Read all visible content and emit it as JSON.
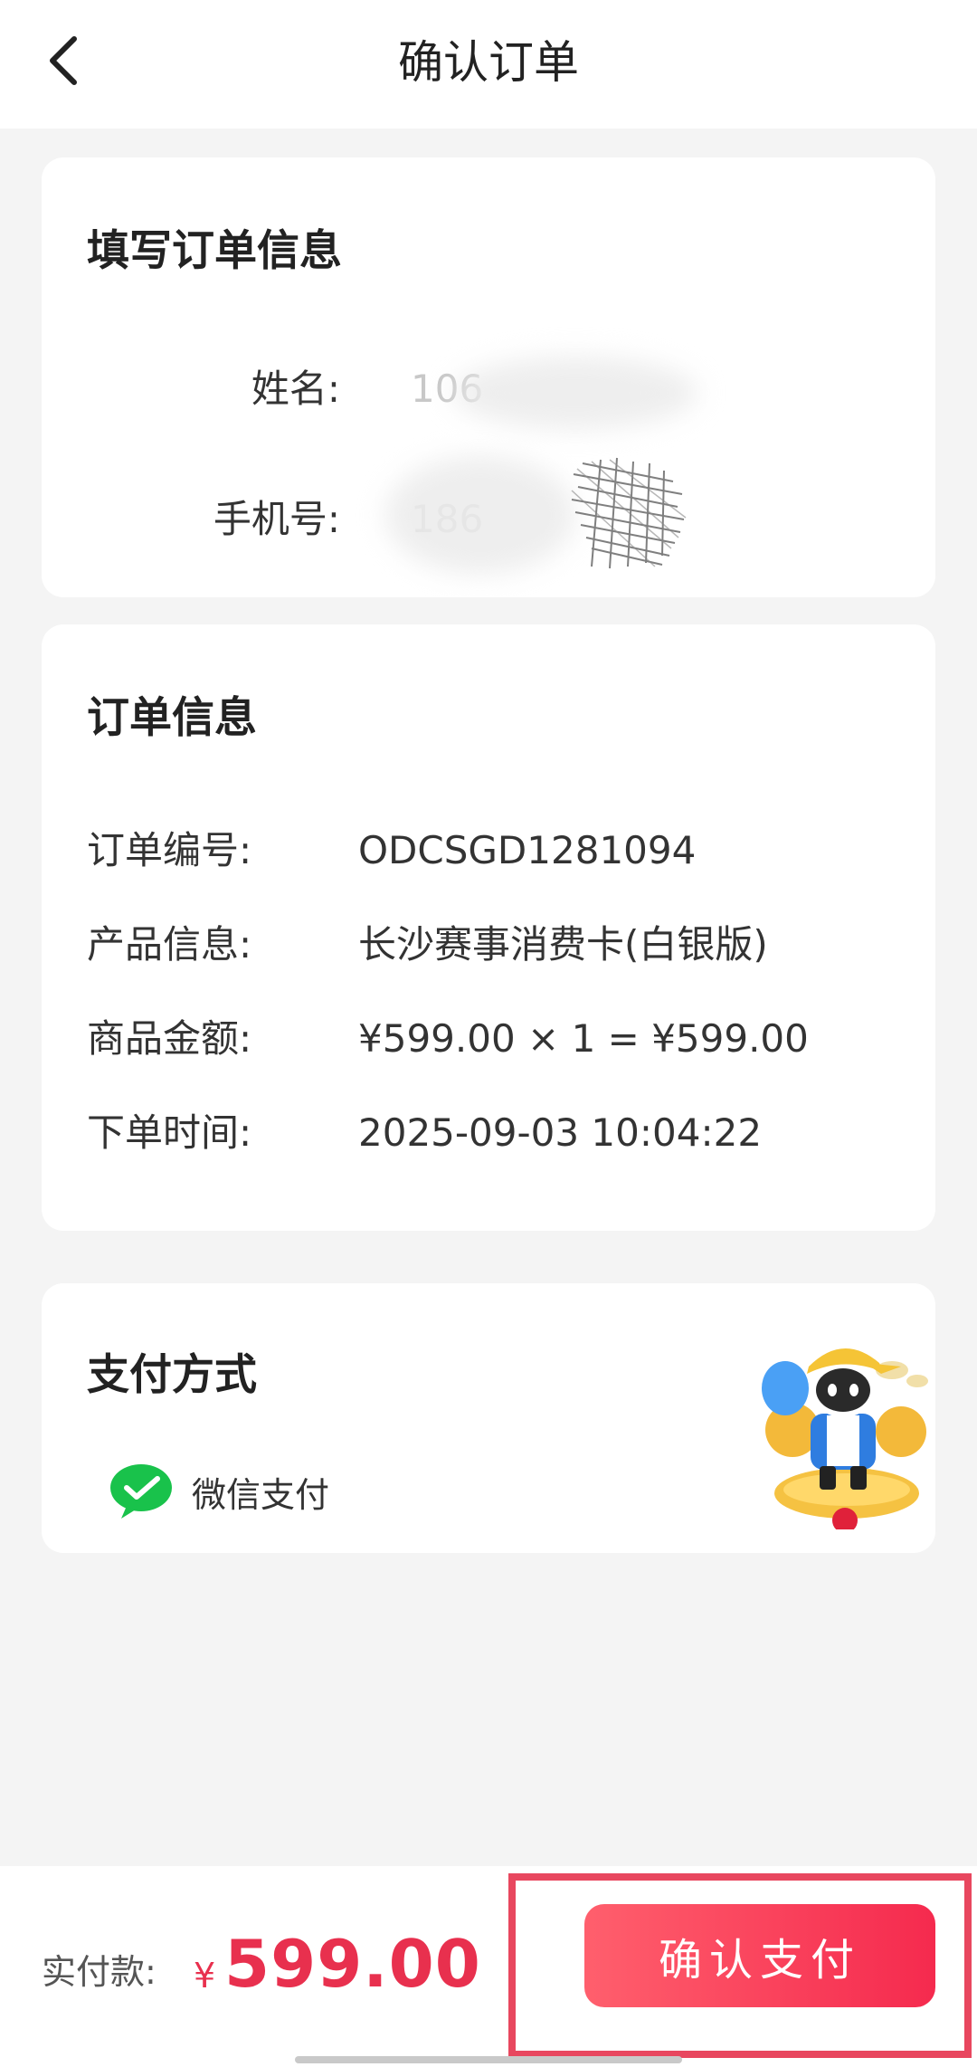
{
  "header": {
    "title": "确认订单",
    "back_icon": "chevron-left-icon"
  },
  "fill_info": {
    "title": "填写订单信息",
    "fields": [
      {
        "label": "姓名:",
        "value": "106"
      },
      {
        "label": "手机号:",
        "value": "186"
      }
    ]
  },
  "order_info": {
    "title": "订单信息",
    "rows": [
      {
        "label": "订单编号:",
        "value": "ODCSGD1281094"
      },
      {
        "label": "产品信息:",
        "value": "长沙赛事消费卡(白银版)"
      },
      {
        "label": "商品金额:",
        "value": "¥599.00 × 1 = ¥599.00"
      },
      {
        "label": "下单时间:",
        "value": "2025-09-03 10:04:22"
      }
    ]
  },
  "payment": {
    "title": "支付方式",
    "method_label": "微信支付",
    "method_icon": "wechat-pay-icon",
    "mascot": "mascot-illustration"
  },
  "footer": {
    "paid_label": "实付款:",
    "currency": "¥",
    "amount": "599.00",
    "confirm_label": "确认支付"
  },
  "colors": {
    "accent": "#e8304e",
    "button_gradient_start": "#ff5f6d",
    "button_gradient_end": "#f52a4e",
    "highlight_border": "#e8475f",
    "wechat_green": "#19c24b",
    "background": "#f4f4f4"
  }
}
